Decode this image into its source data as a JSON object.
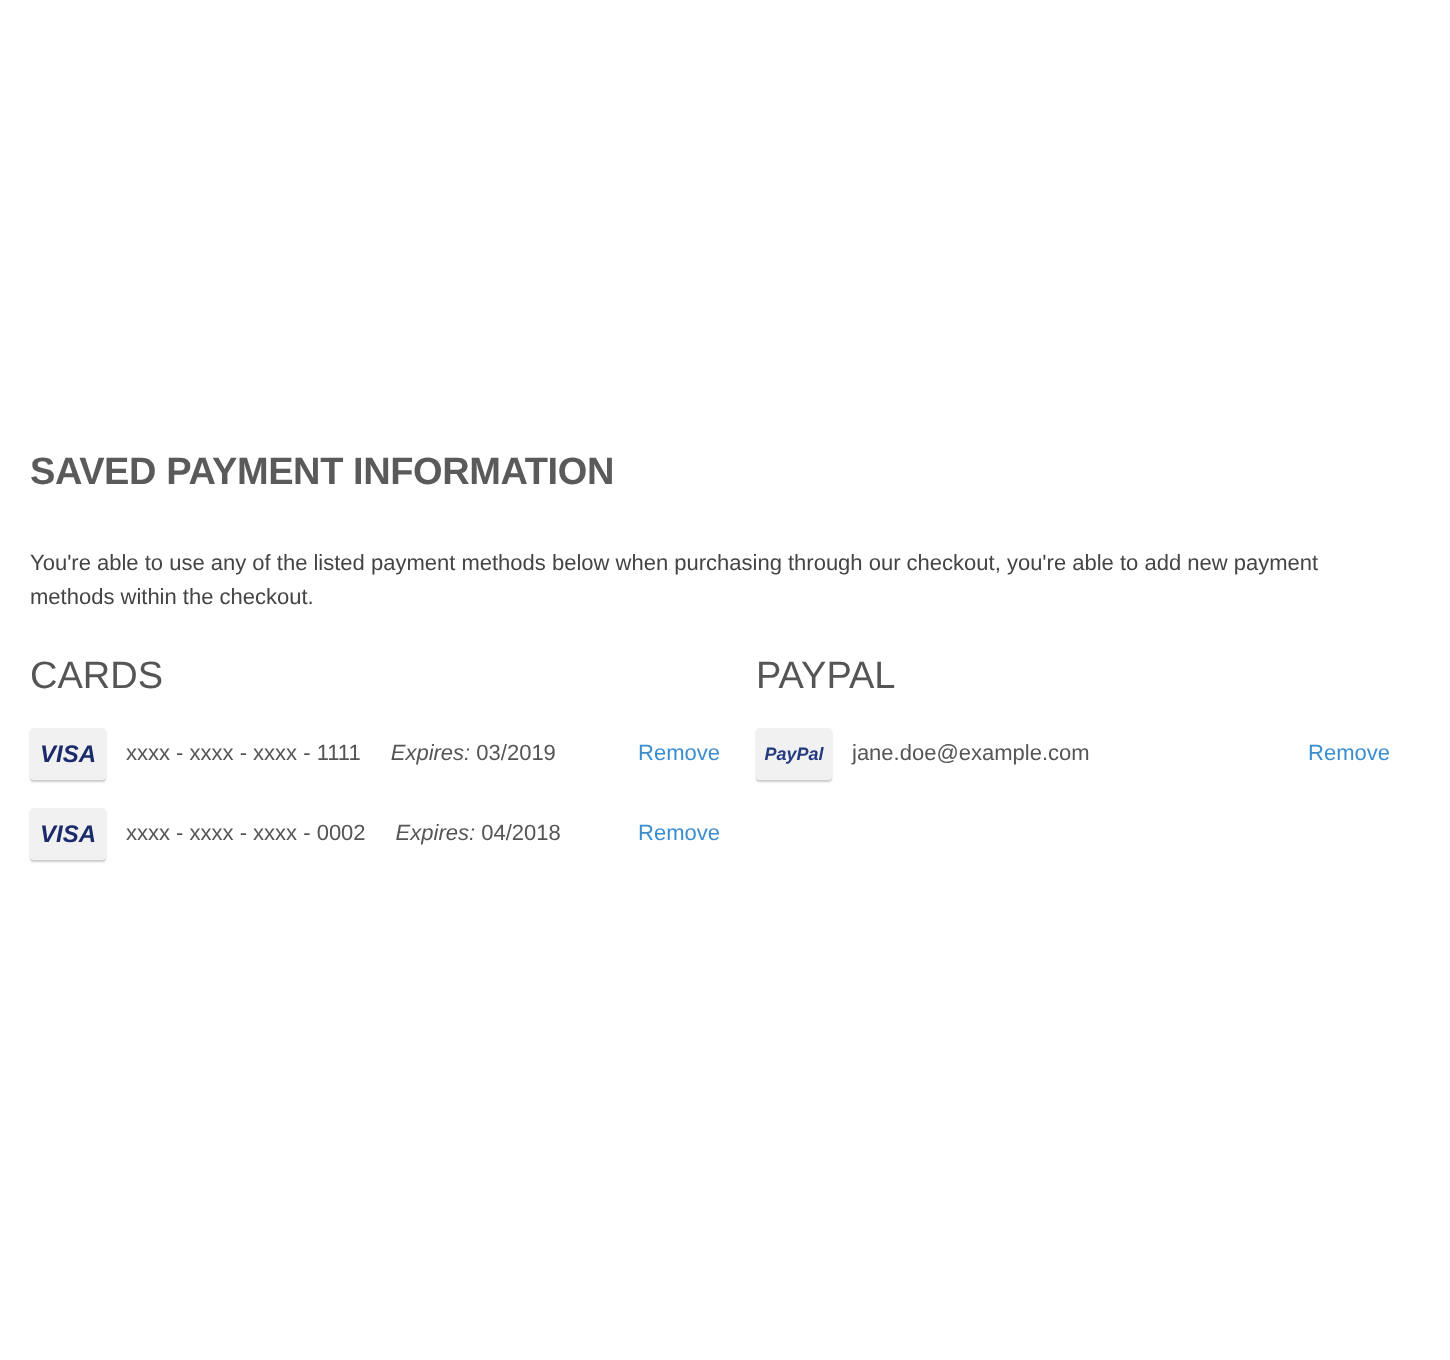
{
  "title": "SAVED PAYMENT INFORMATION",
  "intro": "You're able to use any of the listed payment methods below when purchasing through our checkout, you're able to add new payment methods within the checkout.",
  "sections": [
    {
      "heading": "CARDS",
      "items": [
        {
          "kind": "card",
          "brand": "VISA",
          "number": "xxxx - xxxx - xxxx - 1111",
          "expires_label": "Expires:",
          "expires": "03/2019",
          "action": "Remove"
        },
        {
          "kind": "card",
          "brand": "VISA",
          "number": "xxxx - xxxx - xxxx - 0002",
          "expires_label": "Expires:",
          "expires": "04/2018",
          "action": "Remove"
        }
      ]
    },
    {
      "heading": "PAYPAL",
      "items": [
        {
          "kind": "paypal",
          "brand": "PayPal",
          "email": "jane.doe@example.com",
          "action": "Remove"
        }
      ]
    }
  ]
}
